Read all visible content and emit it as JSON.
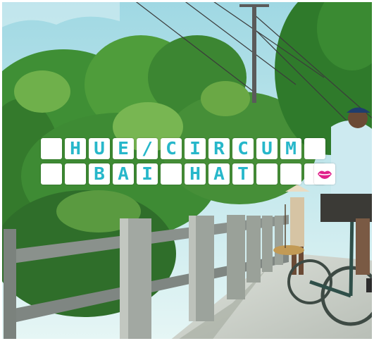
{
  "cover": {
    "row1_text": "HUE/CIRCUM",
    "row2_text": "BAI HAT",
    "row1_letters": [
      "",
      "H",
      "U",
      "E",
      "/",
      "C",
      "I",
      "R",
      "C",
      "U",
      "M",
      ""
    ],
    "row2_letters": [
      "",
      "",
      "B",
      "A",
      "I",
      "",
      "H",
      "A",
      "T",
      "",
      "",
      ""
    ]
  },
  "colors": {
    "letter": "#27b7ca",
    "tile": "#ffffff",
    "lips_icon": "#e0218a",
    "sky": "#bfe7ee",
    "foliage": "#3a8a32",
    "bridge": "#8c948f",
    "road": "#cfd3cd"
  },
  "icons": {
    "badge": "lips-icon"
  }
}
